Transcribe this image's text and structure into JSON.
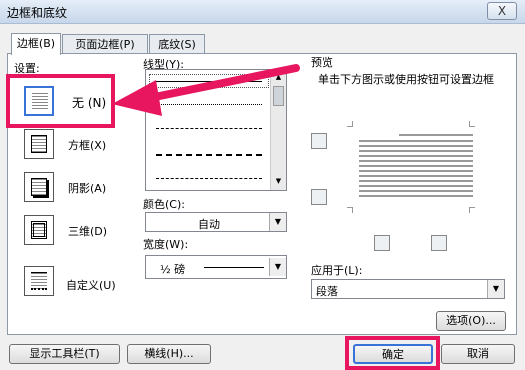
{
  "window": {
    "title": "边框和底纹",
    "close": "X"
  },
  "tabs": [
    {
      "label": "边框(B)",
      "active": true
    },
    {
      "label": "页面边框(P)",
      "active": false
    },
    {
      "label": "底纹(S)",
      "active": false
    }
  ],
  "settings": {
    "label": "设置:",
    "items": [
      {
        "label": "无 (N)",
        "selected": true,
        "icon": "border-none-icon"
      },
      {
        "label": "方框(X)",
        "icon": "border-box-icon"
      },
      {
        "label": "阴影(A)",
        "icon": "border-shadow-icon"
      },
      {
        "label": "三维(D)",
        "icon": "border-3d-icon"
      },
      {
        "label": "自定义(U)",
        "icon": "border-custom-icon"
      }
    ]
  },
  "style": {
    "label": "线型(Y):",
    "color_label": "颜色(C):",
    "color_value": "自动",
    "width_label": "宽度(W):",
    "width_value": "½ 磅"
  },
  "preview": {
    "label": "预览",
    "hint": "单击下方图示或使用按钮可设置边框",
    "apply_label": "应用于(L):",
    "apply_value": "段落",
    "options_button": "选项(O)..."
  },
  "footer": {
    "toolbar_button": "显示工具栏(T)",
    "hline_button": "横线(H)...",
    "ok_button": "确定",
    "cancel_button": "取消"
  },
  "colors": {
    "highlight": "#e8155f",
    "accent": "#3874d8"
  }
}
